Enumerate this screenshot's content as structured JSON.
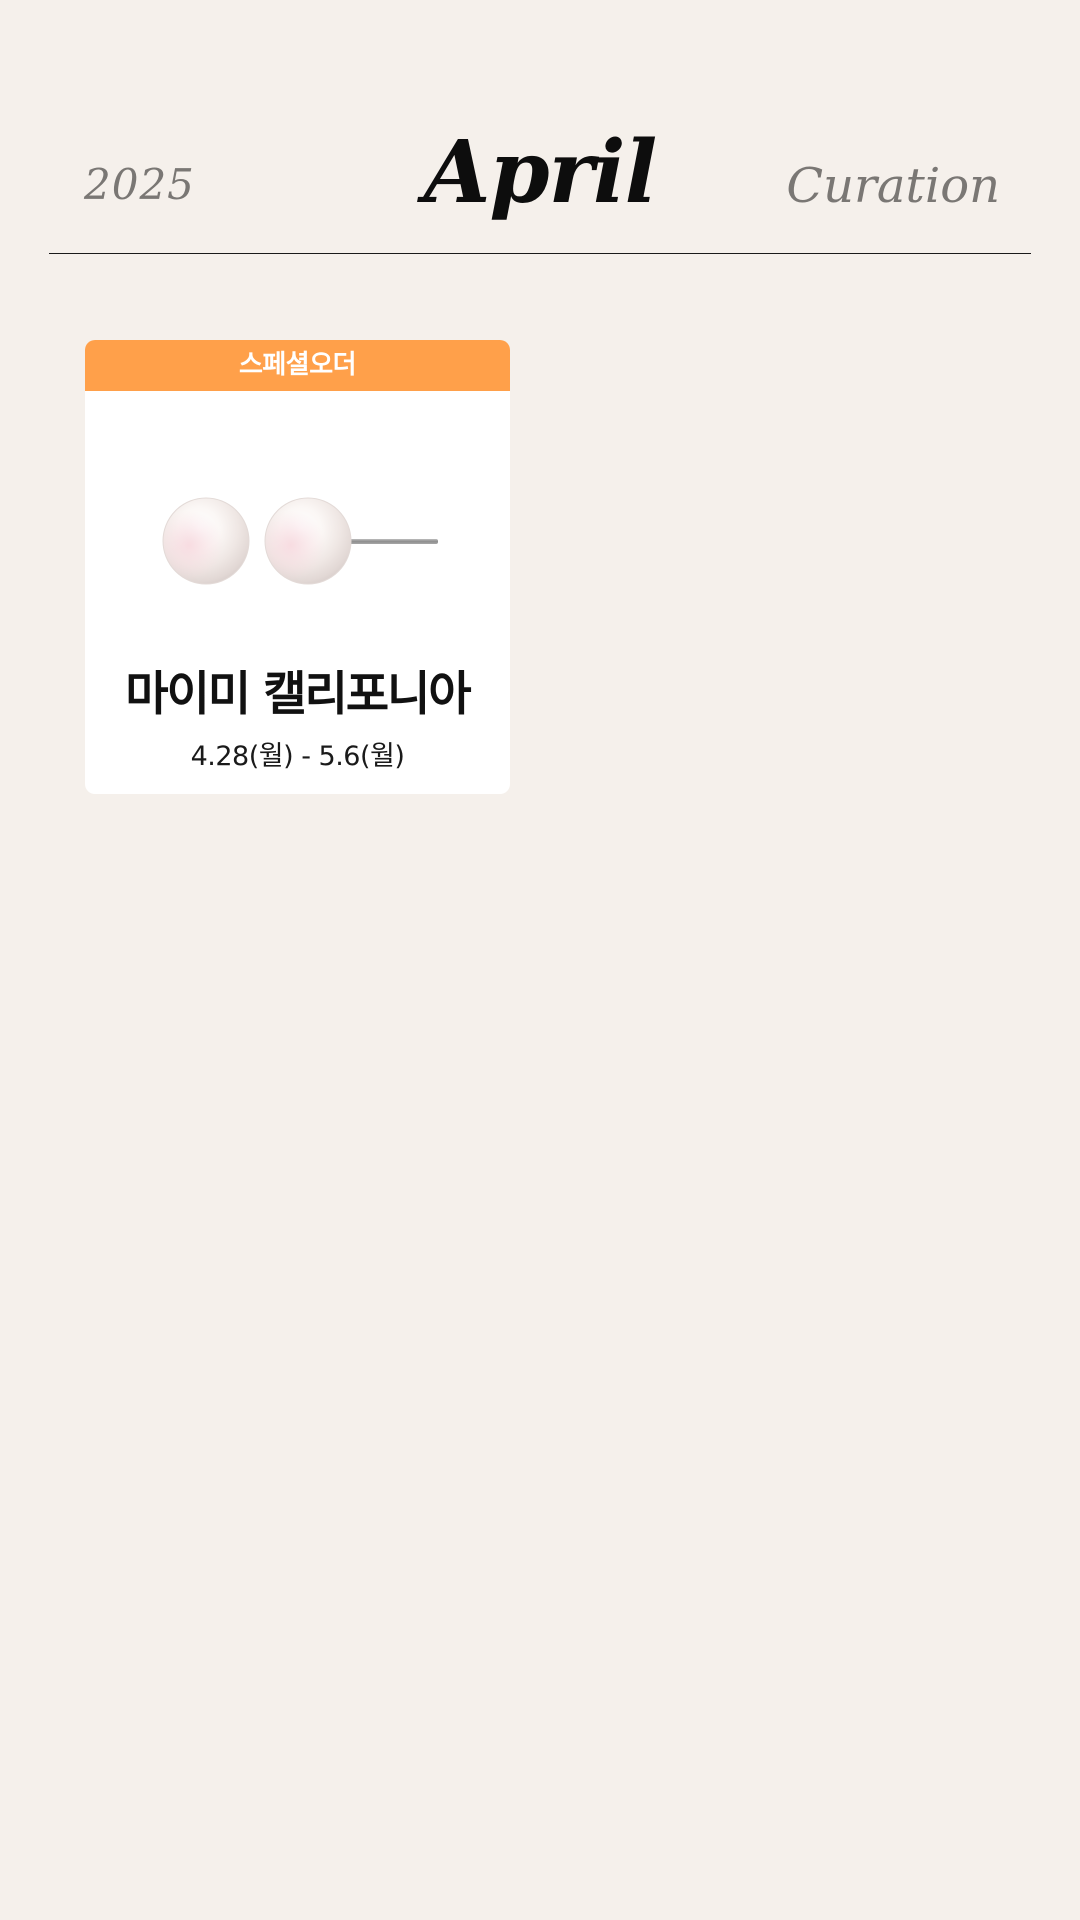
{
  "header": {
    "year": "2025",
    "month": "April",
    "label": "Curation"
  },
  "cards": [
    {
      "badge": "스페셜오더",
      "title": "마이미 캘리포니아",
      "date_range": "4.28(월) - 5.6(월)",
      "image_icon": "pearl-earrings-icon"
    }
  ],
  "colors": {
    "background": "#f5f0eb",
    "badge": "#ffa04a",
    "card": "#ffffff",
    "text_dark": "#111111",
    "text_muted": "#7a7774"
  }
}
